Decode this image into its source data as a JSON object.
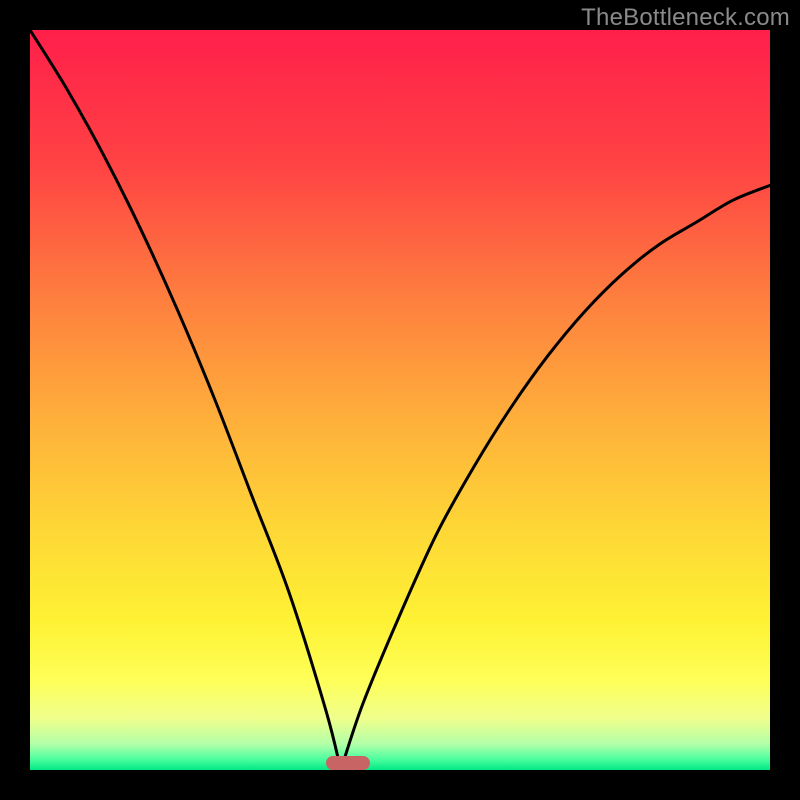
{
  "watermark": "TheBottleneck.com",
  "colors": {
    "frame": "#000000",
    "curve": "#000000",
    "marker": "#c86464",
    "watermark": "#8a8a8a",
    "gradient_stops": [
      {
        "offset": 0.0,
        "color": "#ff1f4a"
      },
      {
        "offset": 0.18,
        "color": "#ff4244"
      },
      {
        "offset": 0.38,
        "color": "#fe843e"
      },
      {
        "offset": 0.55,
        "color": "#feb63a"
      },
      {
        "offset": 0.68,
        "color": "#fed836"
      },
      {
        "offset": 0.8,
        "color": "#fef234"
      },
      {
        "offset": 0.88,
        "color": "#feff59"
      },
      {
        "offset": 0.93,
        "color": "#f0ff8c"
      },
      {
        "offset": 0.965,
        "color": "#b2ffa8"
      },
      {
        "offset": 0.985,
        "color": "#4effa0"
      },
      {
        "offset": 1.0,
        "color": "#00e884"
      }
    ]
  },
  "chart_data": {
    "type": "line",
    "title": "",
    "xlabel": "",
    "ylabel": "",
    "xlim": [
      0,
      100
    ],
    "ylim": [
      0,
      100
    ],
    "x_min_point": 42,
    "marker": {
      "x_start": 40,
      "x_end": 46,
      "y": 0
    },
    "series": [
      {
        "name": "left-branch",
        "x": [
          0,
          5,
          10,
          15,
          20,
          25,
          30,
          35,
          40,
          42
        ],
        "values": [
          100,
          92,
          83,
          73,
          62,
          50,
          37,
          24,
          8,
          0
        ]
      },
      {
        "name": "right-branch",
        "x": [
          42,
          45,
          50,
          55,
          60,
          65,
          70,
          75,
          80,
          85,
          90,
          95,
          100
        ],
        "values": [
          0,
          9,
          21,
          32,
          41,
          49,
          56,
          62,
          67,
          71,
          74,
          77,
          79
        ]
      }
    ]
  }
}
